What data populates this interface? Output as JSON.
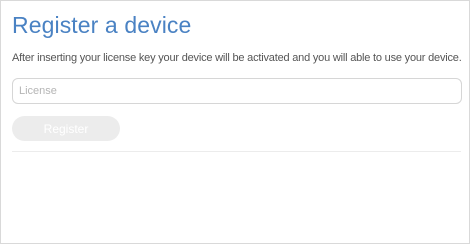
{
  "register": {
    "title": "Register a device",
    "description": "After inserting your license key your device will be activated and you will able to use your device.",
    "license_input": {
      "placeholder": "License",
      "value": ""
    },
    "register_button_label": "Register"
  },
  "colors": {
    "title": "#4a82c3",
    "description_text": "#555555",
    "placeholder": "#b5b5b5",
    "button_disabled_bg": "#ececec",
    "button_text": "#ffffff"
  }
}
